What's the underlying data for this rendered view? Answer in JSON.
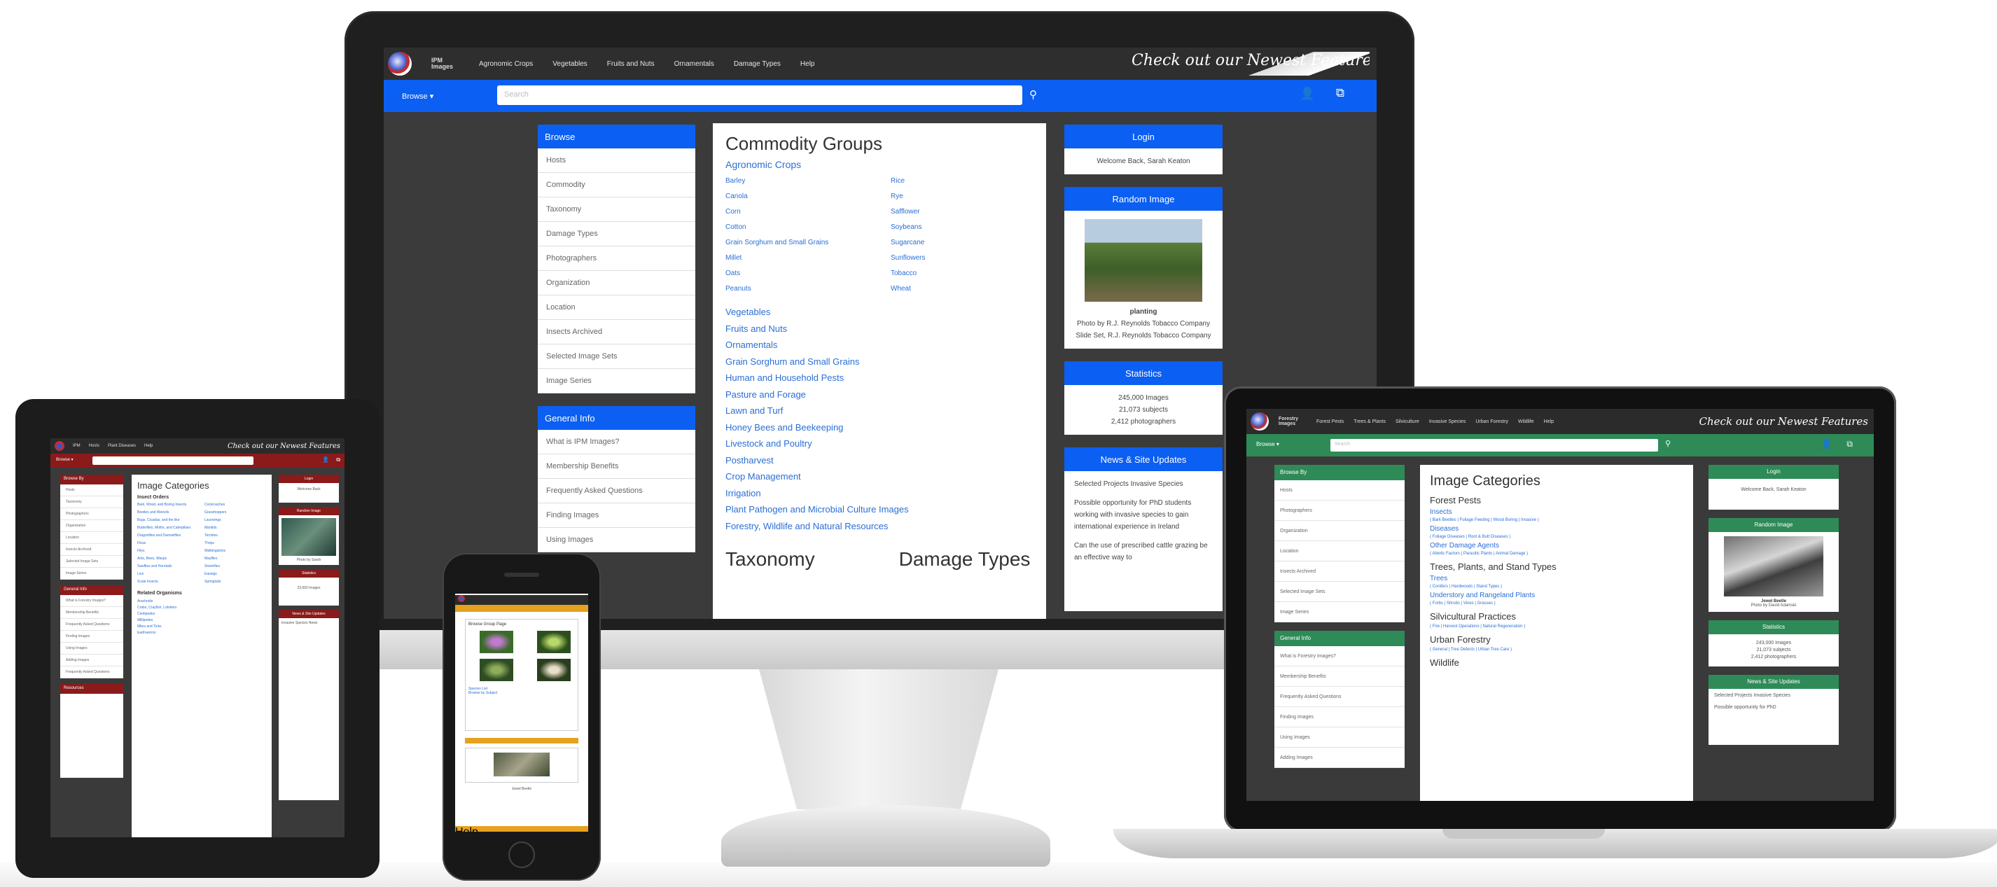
{
  "colors": {
    "monitor_accent": "#0b5ff2",
    "tablet_accent": "#8b1a1a",
    "phone_accent": "#e6a21f",
    "laptop_accent": "#2e8b57"
  },
  "monitor": {
    "logo_text": "IPM Images",
    "nav": [
      "Agronomic Crops",
      "Vegetables",
      "Fruits and Nuts",
      "Ornamentals",
      "Damage Types",
      "Help"
    ],
    "feature_text": "Check out our Newest Features",
    "browse_label": "Browse ▾",
    "search_placeholder": "Search",
    "browse_head": "Browse",
    "browse_items": [
      "Hosts",
      "Commodity",
      "Taxonomy",
      "Damage Types",
      "Photographers",
      "Organization",
      "Location",
      "Insects Archived",
      "Selected Image Sets",
      "Image Series"
    ],
    "general_head": "General Info",
    "general_items": [
      "What is IPM Images?",
      "Membership Benefits",
      "Frequently Asked Questions",
      "Finding Images",
      "Using Images"
    ],
    "center_title": "Commodity Groups",
    "center_sub": "Agronomic Crops",
    "crops_left": [
      "Barley",
      "Canola",
      "Corn",
      "Cotton",
      "Grain Sorghum and Small Grains",
      "Millet",
      "Oats",
      "Peanuts"
    ],
    "crops_right": [
      "Rice",
      "Rye",
      "Safflower",
      "Soybeans",
      "Sugarcane",
      "Sunflowers",
      "Tobacco",
      "Wheat"
    ],
    "categories": [
      "Vegetables",
      "Fruits and Nuts",
      "Ornamentals",
      "Grain Sorghum and Small Grains",
      "Human and Household Pests",
      "Pasture and Forage",
      "Lawn and Turf",
      "Honey Bees and Beekeeping",
      "Livestock and Poultry",
      "Postharvest",
      "Crop Management",
      "Irrigation",
      "Plant Pathogen and Microbial Culture Images",
      "Forestry, Wildlife and Natural Resources"
    ],
    "bottom_left": "Taxonomy",
    "bottom_right": "Damage Types",
    "login_head": "Login",
    "login_text": "Welcome Back, Sarah Keaton",
    "random_head": "Random Image",
    "random_caption": "planting",
    "random_credit": "Photo by R.J. Reynolds Tobacco Company Slide Set, R.J. Reynolds Tobacco Company",
    "stats_head": "Statistics",
    "stats_lines": [
      "245,000 Images",
      "21,073 subjects",
      "2,412 photographers"
    ],
    "news_head": "News & Site Updates",
    "news_items": [
      "Selected Projects Invasive Species",
      "Possible opportunity for PhD students working with invasive species to gain international experience in Ireland",
      "Can the use of prescribed cattle grazing be an effective way to"
    ]
  },
  "tablet": {
    "logo_text": "IPM",
    "nav": [
      "Hosts",
      "Plant Diseases",
      "Help"
    ],
    "feature_text": "Check out our Newest Features",
    "browse_label": "Browse ▾",
    "left_heads": [
      "Browse By",
      "General Info",
      "Resources"
    ],
    "left_items": [
      "Hosts",
      "Taxonomy",
      "Photographers",
      "Organization",
      "Location",
      "Insects Archived",
      "Selected Image Sets",
      "Image Series"
    ],
    "left_items2": [
      "What is Forestry Images?",
      "Membership Benefits",
      "Frequently Asked Questions",
      "Finding Images",
      "Using Images",
      "Adding Images",
      "Frequently Asked Questions"
    ],
    "center_title": "Image Categories",
    "center_sub": "Insect Orders",
    "center_links": [
      "Bark, Wood, and Boring Insects",
      "Cockroaches",
      "Beetles and Weevils",
      "Grasshoppers",
      "Bugs, Cicadas, and the like",
      "Lacewings",
      "Butterflies, Moths, and Caterpillars",
      "Mantids",
      "Dragonflies and Damselflies",
      "Termites",
      "Fleas",
      "Thrips",
      "Flies",
      "Walkingsticks",
      "Ants, Bees, Wasps",
      "Mayflies",
      "Sawflies and Horntails",
      "Stoneflies",
      "Lice",
      "Earwigs",
      "Scale Insects",
      "Springtails"
    ],
    "center_sub2": "Related Organisms",
    "center_links2": [
      "Arachnids",
      "Crabs, Crayfish, Lobsters",
      "Centipedes",
      "Millipedes",
      "Mites and Ticks",
      "Earthworms"
    ],
    "right_heads": [
      "Login",
      "Random Image",
      "Statistics",
      "News & Site Updates"
    ],
    "right_texts": [
      "Welcome Back",
      "Photo by Sarah",
      "23,000 Images",
      "Invasive Species News"
    ]
  },
  "phone": {
    "title": "Browse Group Page",
    "caption": "Jewel Beetle",
    "footer_links": [
      "Species List",
      "Browse by Subject",
      "Help"
    ]
  },
  "laptop": {
    "logo_text": "Forestry Images",
    "nav": [
      "Forest Pests",
      "Trees & Plants",
      "Silviculture",
      "Invasive Species",
      "Urban Forestry",
      "Wildlife",
      "Help"
    ],
    "feature_text": "Check out our Newest Features",
    "browse_label": "Browse ▾",
    "search_placeholder": "Search",
    "browse_head": "Browse By",
    "browse_items": [
      "Hosts",
      "Photographers",
      "Organization",
      "Location",
      "Insects Archived",
      "Selected Image Sets",
      "Image Series"
    ],
    "general_head": "General Info",
    "general_items": [
      "What is Forestry Images?",
      "Membership Benefits",
      "Frequently Asked Questions",
      "Finding Images",
      "Using Images",
      "Adding Images"
    ],
    "center_title": "Image Categories",
    "sections": [
      {
        "title": "Forest Pests",
        "links": [
          {
            "name": "Insects",
            "desc": "( Bark Beetles | Foliage Feeding | Wood Boring | Invasive )"
          },
          {
            "name": "Diseases",
            "desc": "( Foliage Diseases | Root & Butt Diseases )"
          },
          {
            "name": "Other Damage Agents",
            "desc": "( Abiotic Factors | Parasitic Plants | Animal Damage )"
          }
        ]
      },
      {
        "title": "Trees, Plants, and Stand Types",
        "links": [
          {
            "name": "Trees",
            "desc": "( Conifers | Hardwoods | Stand Types )"
          },
          {
            "name": "Understory and Rangeland Plants",
            "desc": "( Forbs | Shrubs | Vines | Grasses )"
          }
        ]
      },
      {
        "title": "Silvicultural Practices",
        "links": [
          {
            "name": "",
            "desc": "( Fire | Harvest Operations | Natural Regeneration )"
          }
        ]
      },
      {
        "title": "Urban Forestry",
        "links": [
          {
            "name": "",
            "desc": "( General | Tree Defects | Urban Tree Care )"
          }
        ]
      },
      {
        "title": "Wildlife",
        "links": []
      }
    ],
    "login_head": "Login",
    "login_text": "Welcome Back, Sarah Keaton",
    "random_head": "Random Image",
    "random_caption": "Jewel Beetle",
    "random_credit": "Photo by David Adamski",
    "stats_head": "Statistics",
    "stats_lines": [
      "243,000 Images",
      "21,073 subjects",
      "2,412 photographers"
    ],
    "news_head": "News & Site Updates",
    "news_items": [
      "Selected Projects Invasive Species",
      "Possible opportunity for PhD"
    ]
  }
}
